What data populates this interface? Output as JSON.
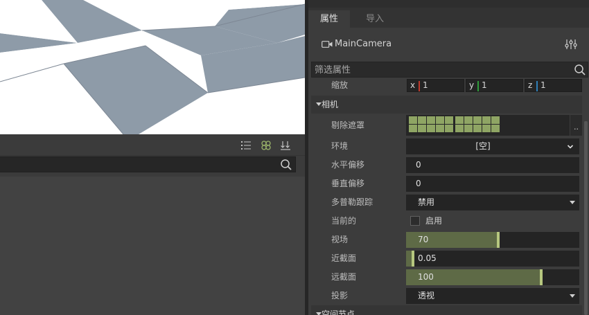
{
  "bottom_panel": {
    "search": {
      "value": "",
      "placeholder": ""
    },
    "toolbar_icons": [
      "list-icon",
      "flower-icon",
      "sort-download-icon"
    ]
  },
  "inspector": {
    "tabs": [
      {
        "label": "属性",
        "active": true
      },
      {
        "label": "导入",
        "active": false
      }
    ],
    "node_name": "MainCamera",
    "filter_placeholder": "筛选属性",
    "scale": {
      "label": "缩放",
      "x": "1",
      "y": "1",
      "z": "1"
    },
    "camera_section": "相机",
    "cull_mask": {
      "label": "剔除遮罩"
    },
    "environment": {
      "label": "环境",
      "value": "[空]"
    },
    "h_offset": {
      "label": "水平偏移",
      "value": "0"
    },
    "v_offset": {
      "label": "垂直偏移",
      "value": "0"
    },
    "doppler": {
      "label": "多普勒跟踪",
      "value": "禁用"
    },
    "current": {
      "label": "当前的",
      "checkbox_label": "启用",
      "checked": false
    },
    "fov": {
      "label": "视场",
      "value": "70",
      "fill": 0.53
    },
    "near": {
      "label": "近截面",
      "value": "0.05",
      "fill": 0.04
    },
    "far": {
      "label": "远截面",
      "value": "100",
      "fill": 0.78
    },
    "projection": {
      "label": "投影",
      "value": "透视"
    },
    "spatial_section": "空间节点"
  },
  "colors": {
    "axis_x": "#c0392b",
    "axis_y": "#2e9e3a",
    "axis_z": "#2f7fb8",
    "accent": "#b6c77f",
    "slider_fill": "#5e6a46",
    "mask_cell": "#8fa564"
  }
}
